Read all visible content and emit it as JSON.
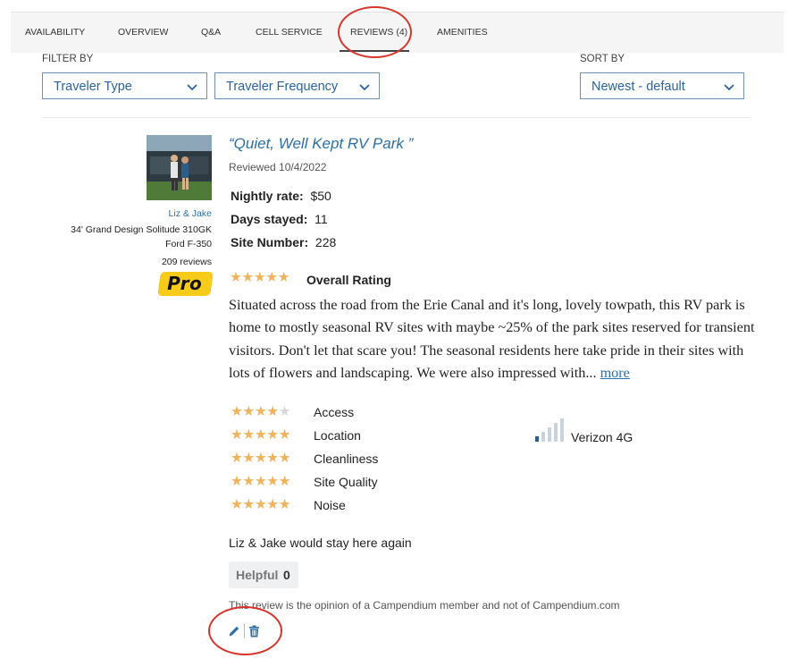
{
  "tabs": [
    {
      "label": "AVAILABILITY"
    },
    {
      "label": "OVERVIEW"
    },
    {
      "label": "Q&A"
    },
    {
      "label": "CELL SERVICE"
    },
    {
      "label": "REVIEWS (4)"
    },
    {
      "label": "AMENITIES"
    }
  ],
  "filters": {
    "filter_label": "FILTER BY",
    "traveler_type": "Traveler Type",
    "traveler_frequency": "Traveler Frequency",
    "sort_label": "SORT BY",
    "sort_value": "Newest - default"
  },
  "reviewer": {
    "name": "Liz & Jake",
    "rig": "34' Grand Design Solitude 310GK",
    "vehicle": "Ford F-350",
    "reviews_count": "209 reviews",
    "badge": "Pro"
  },
  "review": {
    "title": "“Quiet, Well Kept RV Park ”",
    "date": "Reviewed 10/4/2022",
    "stats": [
      {
        "label": "Nightly rate:",
        "value": "$50"
      },
      {
        "label": "Days stayed:",
        "value": "11"
      },
      {
        "label": "Site Number:",
        "value": "228"
      }
    ],
    "overall_label": "Overall Rating",
    "overall_rating": 5,
    "text": "Situated across the road from the Erie Canal and it's long, lovely towpath, this RV park is home to mostly seasonal RV sites with maybe ~25% of the park sites reserved for transient visitors. Don't let that scare you! The seasonal residents here take pride in their sites with lots of flowers and landscaping. We were also impressed with...",
    "more_label": "more",
    "categories": [
      {
        "label": "Access",
        "rating": 4
      },
      {
        "label": "Location",
        "rating": 5
      },
      {
        "label": "Cleanliness",
        "rating": 5
      },
      {
        "label": "Site Quality",
        "rating": 5
      },
      {
        "label": "Noise",
        "rating": 5
      }
    ],
    "cell_service": {
      "carrier": "Verizon 4G",
      "bars": 1
    },
    "would_stay": "Liz & Jake would stay here again",
    "helpful_label": "Helpful",
    "helpful_count": "0",
    "disclaimer": "This review is the opinion of a Campendium member and not of Campendium.com"
  },
  "colors": {
    "accent": "#2a6fa8",
    "star": "#f0b35c",
    "annotation": "#d9342b",
    "pro_badge": "#f6cb1a"
  }
}
